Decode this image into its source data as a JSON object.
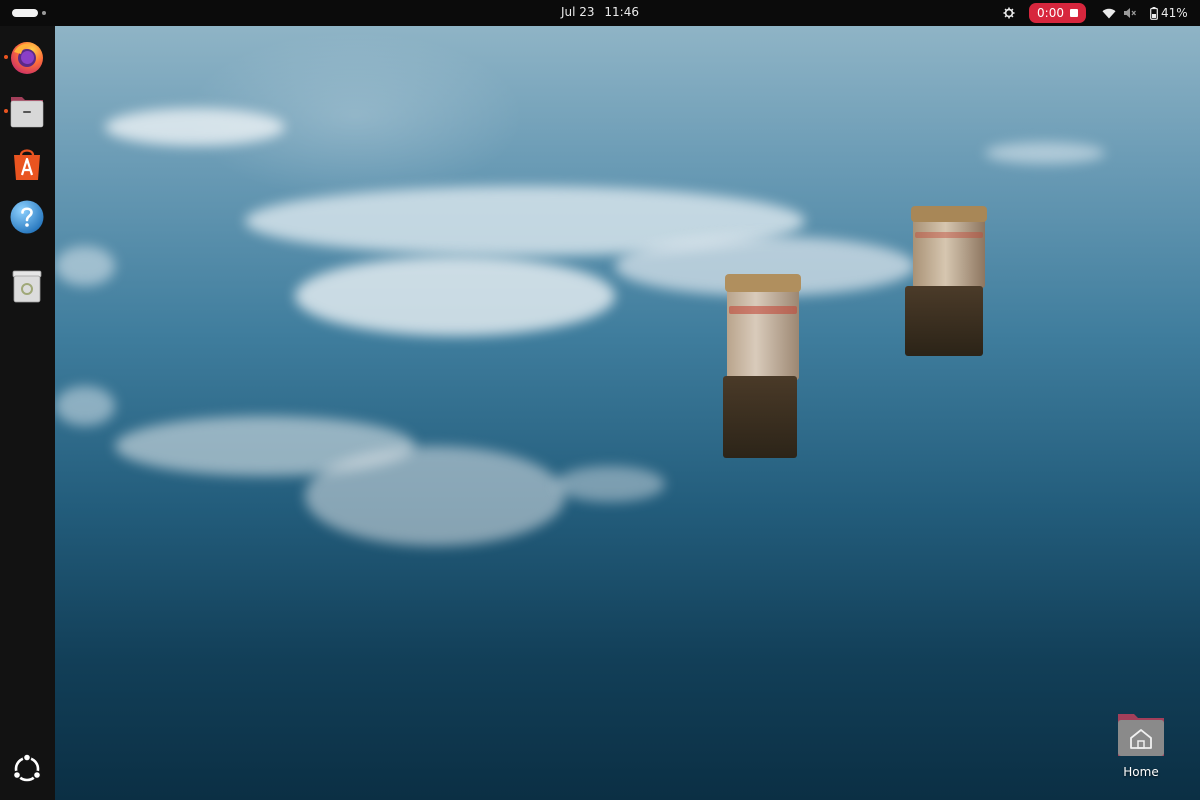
{
  "topbar": {
    "date": "Jul 23",
    "time": "11:46",
    "recording_timer": "0:00",
    "battery_percent": "41%"
  },
  "dock": {
    "items": [
      {
        "name": "Firefox",
        "icon": "firefox-icon",
        "running": true
      },
      {
        "name": "Files",
        "icon": "files-icon",
        "running": true
      },
      {
        "name": "App Center",
        "icon": "app-center-icon",
        "running": false
      },
      {
        "name": "Help",
        "icon": "help-icon",
        "running": false
      },
      {
        "name": "Trash",
        "icon": "trash-icon",
        "running": false
      }
    ],
    "show_apps_icon": "ubuntu-logo-icon"
  },
  "desktop": {
    "home_label": "Home"
  },
  "colors": {
    "accent": "#e95420",
    "recording": "#d7263d",
    "panel": "#0b0b0b"
  }
}
